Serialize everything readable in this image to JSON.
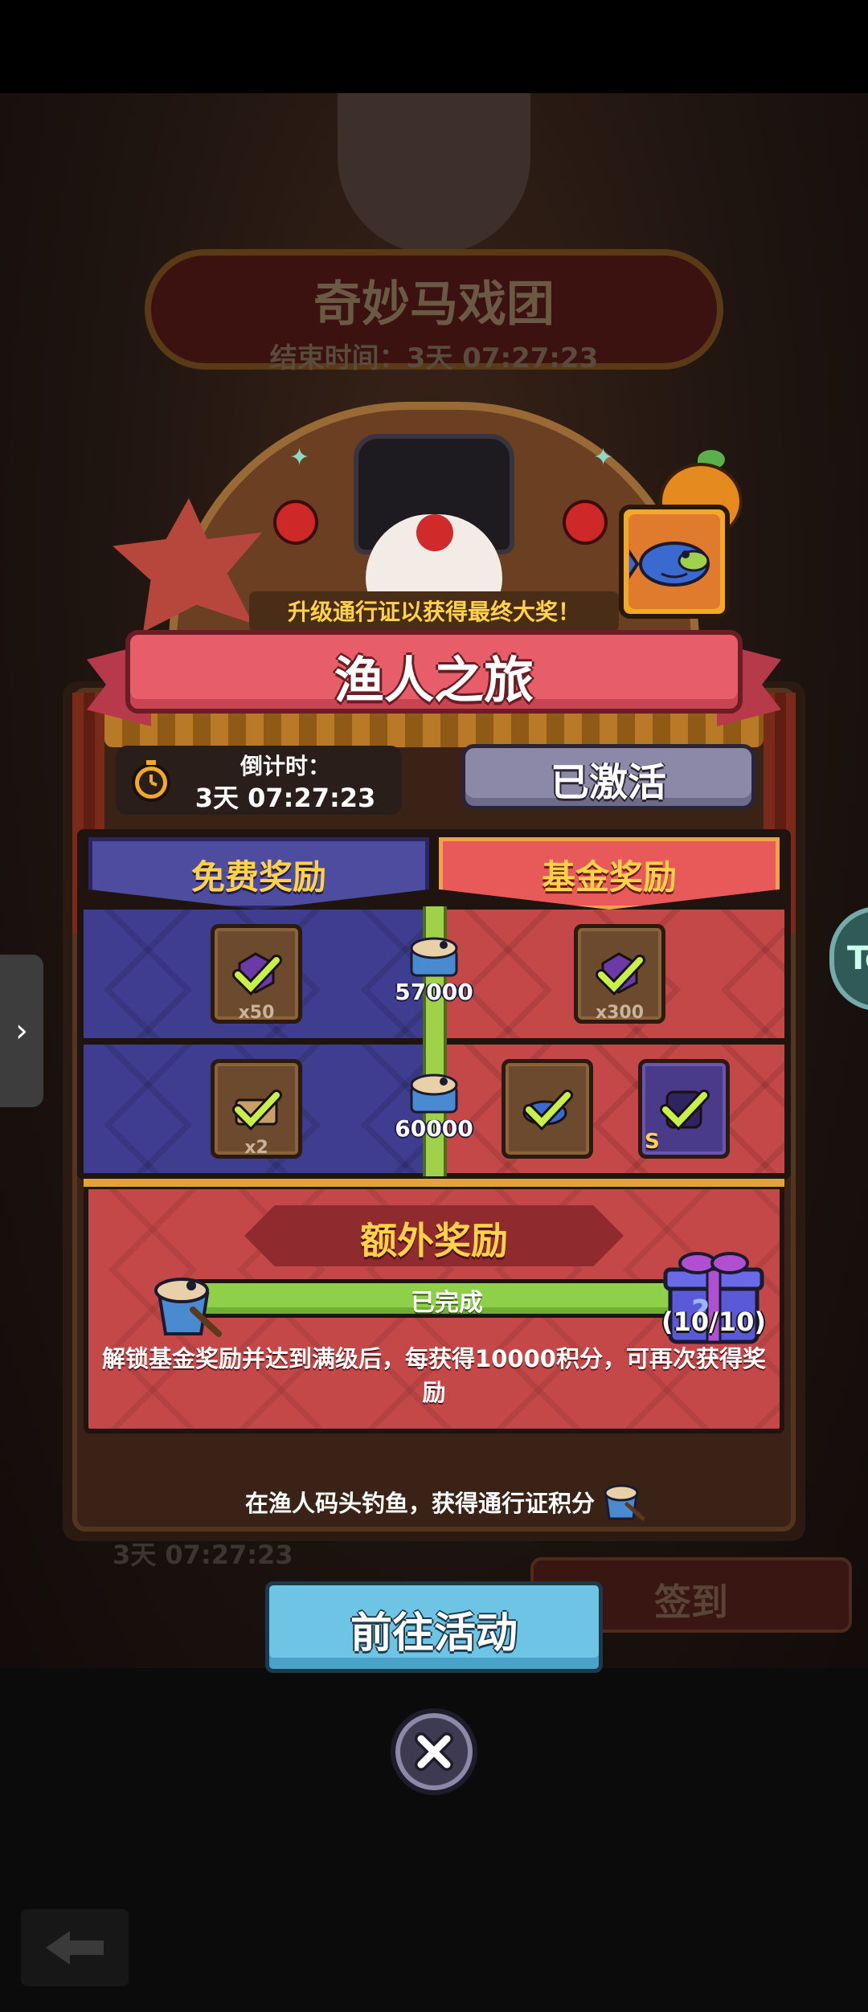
{
  "background": {
    "event_title": "奇妙马戏团",
    "event_timer": "结束时间：3天 07:27:23",
    "bottom_timer": "3天 07:27:23",
    "signin_label": "签到",
    "side_badge_text": "To"
  },
  "header": {
    "subtitle": "升级通行证以获得最终大奖！",
    "title": "渔人之旅"
  },
  "countdown": {
    "label": "倒计时：",
    "time": "3天 07:27:23"
  },
  "status_button": {
    "label": "已激活"
  },
  "rewards": {
    "free_label": "免费奖励",
    "fund_label": "基金奖励",
    "rows": [
      {
        "level": "57000",
        "free_count": "x50",
        "fund_count": "x300"
      },
      {
        "level": "60000",
        "free_count": "x2",
        "fund_badge": "S"
      }
    ]
  },
  "extra": {
    "title": "额外奖励",
    "progress_label": "已完成",
    "progress_fraction": 1.0,
    "count": "(10/10)",
    "description": "解锁基金奖励并达到满级后，每获得10000积分，可再次获得奖励"
  },
  "footer": {
    "note": "在渔人码头钓鱼，获得通行证积分"
  },
  "go_button": {
    "label": "前往活动"
  },
  "colors": {
    "accent_red": "#e85d6a",
    "free_blue": "#3f3d8f",
    "fund_red": "#c44848",
    "progress_green": "#8ed04a",
    "title_gold": "#ffd24a",
    "go_blue": "#6ec4e4"
  },
  "icons": [
    "clock-icon",
    "check-icon",
    "fishing-bucket-icon",
    "mystery-gift-icon",
    "fish-icon",
    "close-icon",
    "back-arrow-icon",
    "chevron-right-icon"
  ]
}
